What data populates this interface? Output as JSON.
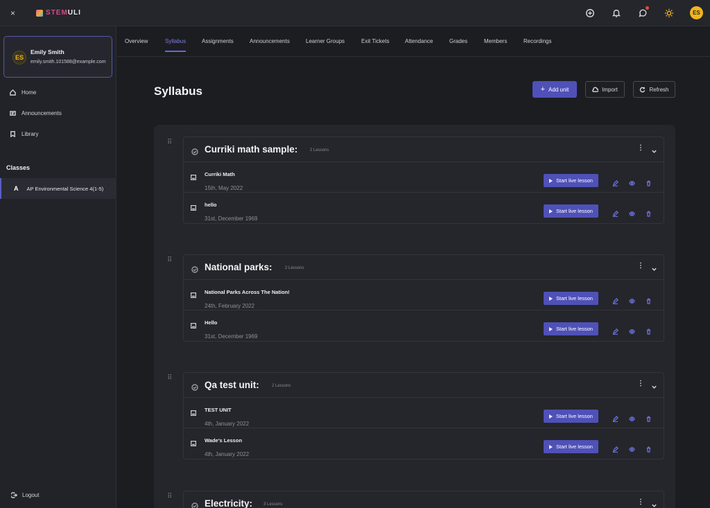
{
  "app": {
    "close_glyph": "×",
    "brand_a": "STEM",
    "brand_b": "ULI",
    "user_initials": "ES"
  },
  "sidebar": {
    "user": {
      "initials": "ES",
      "name": "Emily Smith",
      "email": "emily.smith.101588@example.com"
    },
    "items": [
      {
        "label": "Home",
        "icon": "home-icon"
      },
      {
        "label": "Announcements",
        "icon": "announcement-icon"
      },
      {
        "label": "Library",
        "icon": "bookmark-icon"
      }
    ],
    "classes_heading": "Classes",
    "class_item": {
      "letter": "A",
      "label": "AP Environmental Science 4(1-5)"
    },
    "logout_label": "Logout"
  },
  "tabs": [
    "Overview",
    "Syllabus",
    "Assignments",
    "Announcements",
    "Learner Groups",
    "Exit Tickets",
    "Attendance",
    "Grades",
    "Members",
    "Recordings"
  ],
  "active_tab": "Syllabus",
  "header": {
    "title": "Syllabus",
    "add_unit": "Add unit",
    "import": "Import",
    "refresh": "Refresh"
  },
  "start_label": "Start live lesson",
  "units": [
    {
      "title": "Curriki math sample:",
      "count": "2 Lessons",
      "lessons": [
        {
          "title": "Curriki Math",
          "date": "15th, May 2022"
        },
        {
          "title": "hello",
          "date": "31st, December 1969"
        }
      ]
    },
    {
      "title": "National parks:",
      "count": "2 Lessons",
      "lessons": [
        {
          "title": "National Parks Across The Nation!",
          "date": "24th, February 2022"
        },
        {
          "title": "Hello",
          "date": "31st, December 1969"
        }
      ]
    },
    {
      "title": "Qa test unit:",
      "count": "2 Lessons",
      "lessons": [
        {
          "title": "TEST UNIT",
          "date": "4th, January 2022"
        },
        {
          "title": "Wade's Lesson",
          "date": "4th, January 2022"
        }
      ]
    },
    {
      "title": "Electricity:",
      "count": "3 Lessons",
      "lessons": []
    }
  ],
  "colors": {
    "accent": "#4f51b8",
    "active_tab": "#7c7fe0",
    "avatar": "#f2b51c"
  }
}
